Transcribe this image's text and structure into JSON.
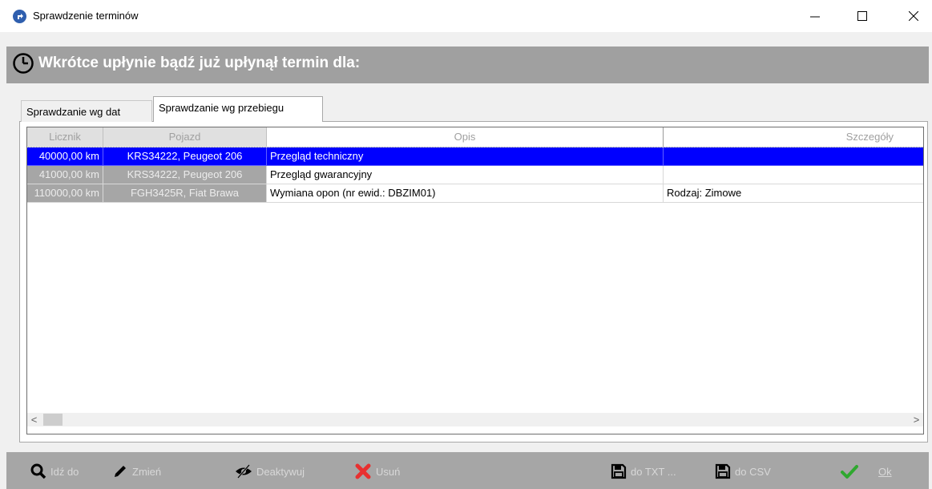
{
  "window": {
    "title": "Sprawdzenie terminów",
    "controls": {
      "minimize": "—",
      "maximize": "☐",
      "close": "✕"
    }
  },
  "header": {
    "icon": "clock-icon",
    "title": "Wkrótce upłynie bądź już upłynął termin dla:"
  },
  "tabs": [
    {
      "label": "Sprawdzanie wg dat",
      "active": false
    },
    {
      "label": "Sprawdzanie wg przebiegu",
      "active": true
    }
  ],
  "grid": {
    "columns": [
      "Licznik",
      "Pojazd",
      "Opis",
      "Szczegóły"
    ],
    "rows": [
      {
        "licznik": "40000,00 km",
        "pojazd": "KRS34222, Peugeot 206",
        "opis": "Przegląd techniczny",
        "szczegoly": "",
        "selected": true
      },
      {
        "licznik": "41000,00 km",
        "pojazd": "KRS34222, Peugeot 206",
        "opis": "Przegląd gwarancyjny",
        "szczegoly": "",
        "selected": false
      },
      {
        "licznik": "110000,00 km",
        "pojazd": "FGH3425R, Fiat Brawa",
        "opis": "Wymiana opon (nr ewid.: DBZIM01)",
        "szczegoly": "Rodzaj: Zimowe",
        "selected": false
      }
    ]
  },
  "scrollbar": {
    "left_arrow": "<",
    "right_arrow": ">"
  },
  "toolbar": {
    "idz_do": "Idź do",
    "zmien": "Zmień",
    "deaktywuj": "Deaktywuj",
    "usun": "Usuń",
    "do_txt": "do TXT ...",
    "do_csv": "do CSV",
    "ok": "Ok"
  },
  "colors": {
    "selection": "#0000ff",
    "header_band": "#a0a0a0",
    "toolbar_bg": "#a6a6a6",
    "ok_check": "#2fa82f",
    "delete_x": "#e83030"
  }
}
